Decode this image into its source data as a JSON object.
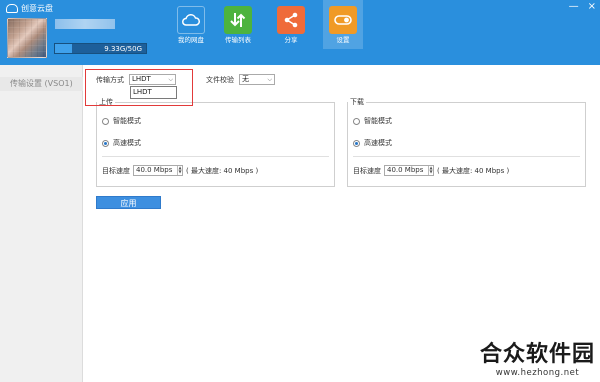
{
  "app": {
    "title": "创意云盘",
    "window_controls": [
      "—",
      "×"
    ]
  },
  "user": {
    "storage_text": "9.33G/50G",
    "storage_fraction": 0.187
  },
  "nav": {
    "items": [
      {
        "label": "我的网盘",
        "icon": "cloud-icon",
        "color": "#2a8fdd"
      },
      {
        "label": "传输列表",
        "icon": "transfer-icon",
        "color": "#4db33e"
      },
      {
        "label": "分享",
        "icon": "share-icon",
        "color": "#ef6b3a"
      },
      {
        "label": "设置",
        "icon": "settings-icon",
        "color": "#f09a26",
        "active": true
      }
    ]
  },
  "sidebar": {
    "items": [
      {
        "label": "传输设置 (VSO1)"
      }
    ]
  },
  "transfer": {
    "mode_label": "传输方式",
    "mode_value": "LHDT",
    "dropdown_option": "LHDT",
    "check_label": "文件校验",
    "check_value": "无"
  },
  "upload": {
    "title": "上传",
    "mode_smart": "智能模式",
    "mode_fast": "高速模式",
    "speed_label": "目标速度",
    "speed_value": "40.0 Mbps",
    "max_speed": "( 最大速度: 40 Mbps )"
  },
  "download": {
    "title": "下载",
    "mode_smart": "智能模式",
    "mode_fast": "高速模式",
    "speed_label": "目标速度",
    "speed_value": "40.0 Mbps",
    "max_speed": "( 最大速度: 40 Mbps )"
  },
  "apply_label": "应用",
  "watermark": {
    "title": "合众软件园",
    "url": "www.hezhong.net"
  },
  "colors": {
    "header": "#2a8fdd",
    "apply": "#3d8fe0",
    "highlight": "#e23a3a"
  }
}
